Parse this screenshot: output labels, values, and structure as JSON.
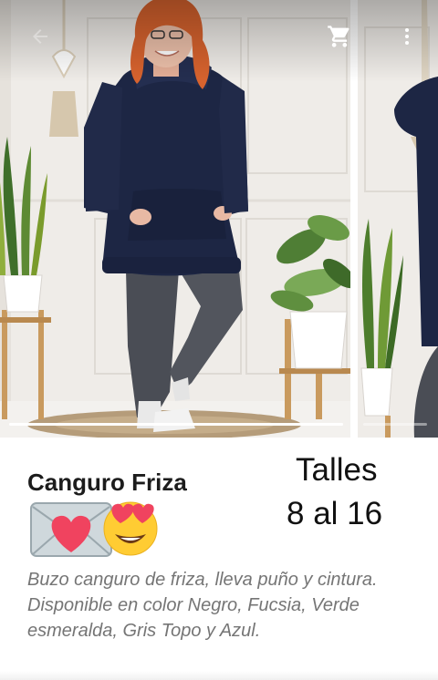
{
  "gallery": {
    "image_count": 2,
    "active_index": 0,
    "progress": [
      1.0,
      0.0
    ]
  },
  "toolbar": {
    "back_icon": "arrow-back-icon",
    "cart_icon": "shopping-cart-icon",
    "more_icon": "more-vert-icon"
  },
  "product": {
    "title": "Canguro Friza",
    "title_emojis": [
      "love-letter",
      "heart-eyes-face"
    ],
    "sizes_line_1": "Talles",
    "sizes_line_2": "8 al 16",
    "description": "Buzo canguro de friza, lleva puño y cintura. Disponible en color Negro, Fucsia, Verde esmeralda, Gris Topo y Azul."
  },
  "colors": {
    "hoodie": "#1d2644",
    "jeans": "#4a4d55",
    "hair": "#d8632e",
    "wall": "#eeebe7",
    "description_text": "#757575"
  }
}
